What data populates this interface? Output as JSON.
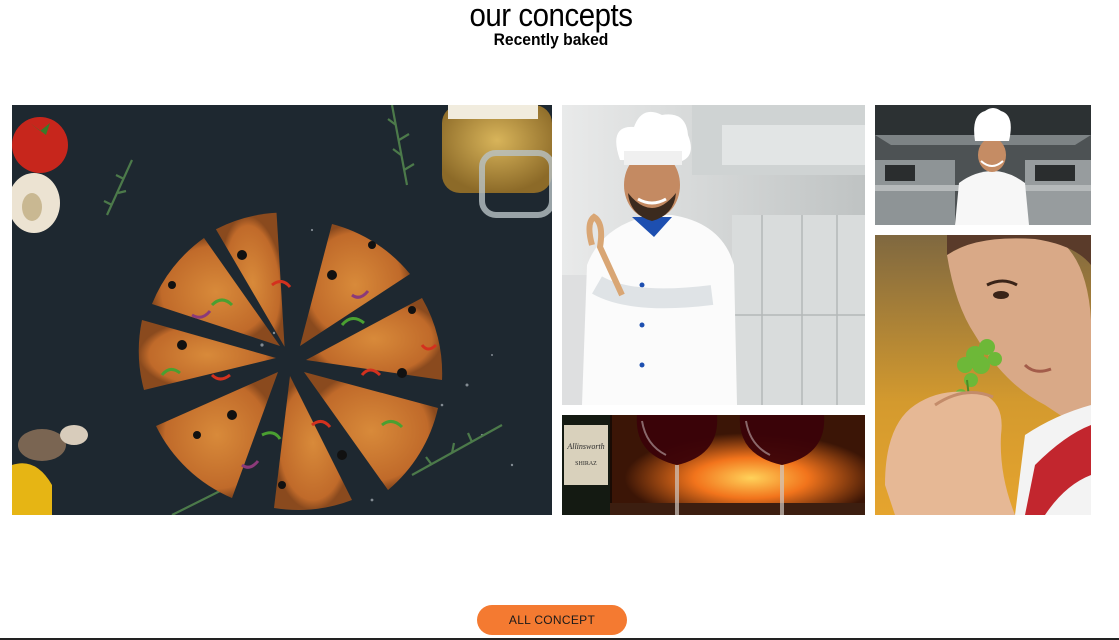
{
  "header": {
    "title": "our concepts",
    "subtitle": "Recently baked"
  },
  "gallery": {
    "tiles": [
      {
        "subject": "sliced pizza on dark board",
        "icon": "pizza-photo"
      },
      {
        "subject": "smiling chef in white uniform",
        "icon": "chef-photo"
      },
      {
        "subject": "red wine glasses by fireplace",
        "icon": "wine-photo"
      },
      {
        "subject": "chef in commercial kitchen",
        "icon": "kitchen-chef-photo"
      },
      {
        "subject": "chef smelling fresh herbs",
        "icon": "herb-chef-photo"
      }
    ]
  },
  "cta": {
    "label": "ALL CONCEPT"
  },
  "colors": {
    "accent": "#f47a31",
    "board": "#1e2830"
  },
  "wine_label": {
    "brand": "Allinsworth",
    "line2": "SHIRAZ"
  }
}
